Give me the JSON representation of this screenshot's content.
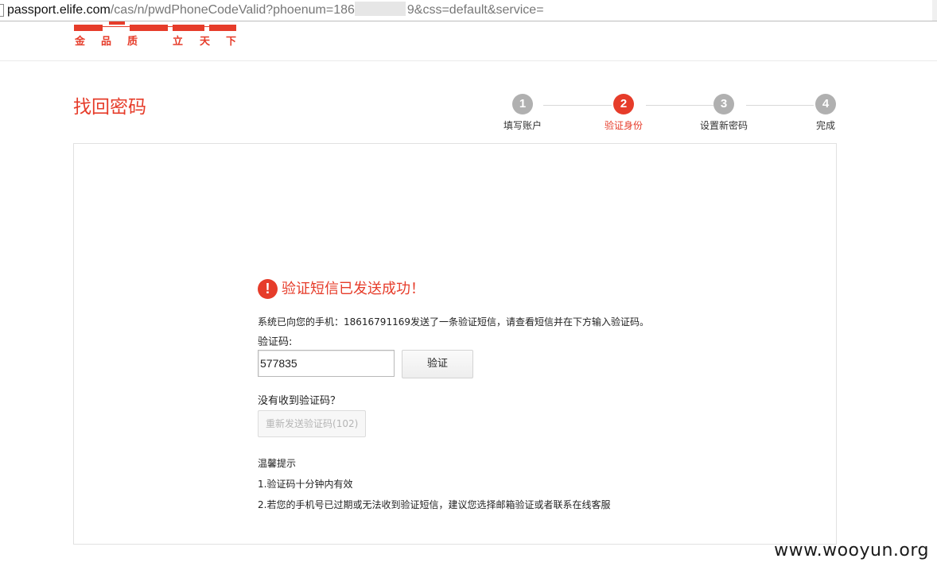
{
  "browser": {
    "url_host": "passport.elife.com",
    "url_path_before_mask": "/cas/n/pwdPhoneCodeValid?phoenum=186",
    "url_path_after_mask": "9&css=default&service="
  },
  "header": {
    "slogan": [
      "金",
      "品",
      "质",
      "立",
      "天",
      "下"
    ]
  },
  "page": {
    "title": "找回密码"
  },
  "steps": [
    {
      "number": "1",
      "label": "填写账户",
      "active": false
    },
    {
      "number": "2",
      "label": "验证身份",
      "active": true
    },
    {
      "number": "3",
      "label": "设置新密码",
      "active": false
    },
    {
      "number": "4",
      "label": "完成",
      "active": false
    }
  ],
  "notice": {
    "icon": "exclamation-icon",
    "icon_glyph": "!",
    "title": "验证短信已发送成功！",
    "message": "系统已向您的手机：18616791169发送了一条验证短信，请查看短信并在下方输入验证码。"
  },
  "form": {
    "code_label": "验证码:",
    "code_value": "577835",
    "verify_label": "验证",
    "no_code_label": "没有收到验证码？",
    "resend_label": "重新发送验证码",
    "resend_countdown": "(102)"
  },
  "tips": {
    "title": "温馨提示",
    "items": [
      "1.验证码十分钟内有效",
      "2.若您的手机号已过期或无法收到验证短信，建议您选择邮箱验证或者联系在线客服"
    ]
  },
  "watermark": "www.wooyun.org",
  "colors": {
    "accent": "#e63c2a",
    "step_inactive": "#b0b0b0",
    "border": "#e1e1e1"
  }
}
